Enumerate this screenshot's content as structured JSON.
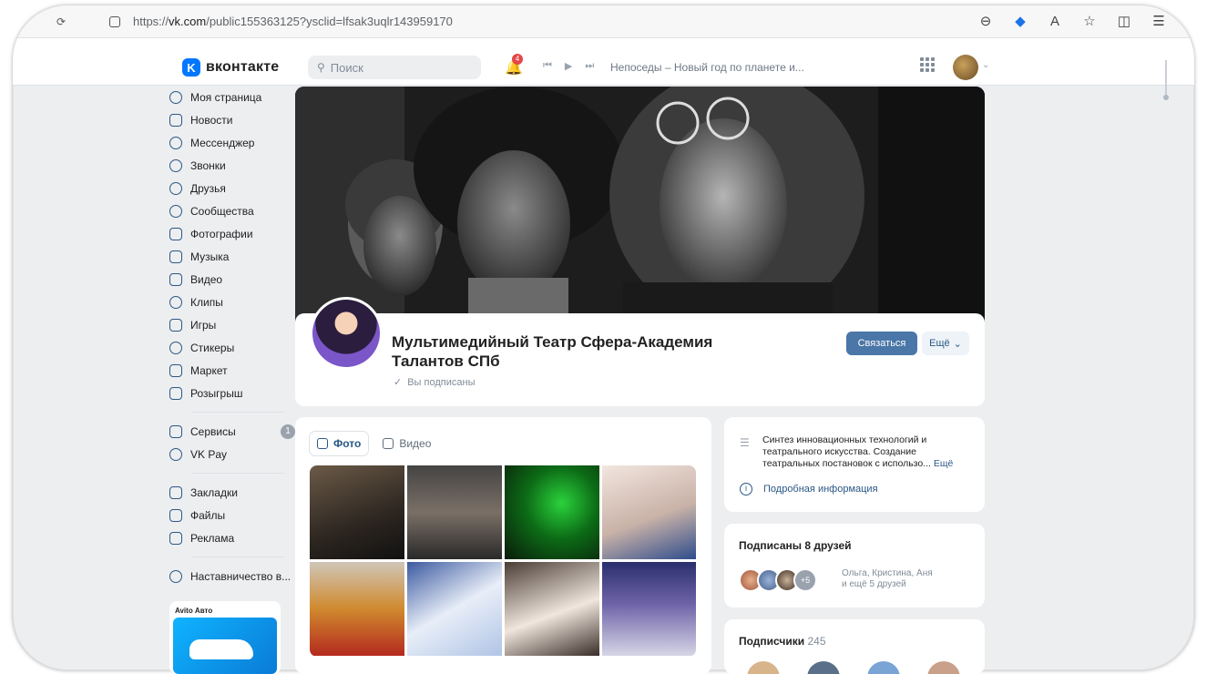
{
  "browser": {
    "url_prefix": "https://",
    "url_domain": "vk.com",
    "url_rest": "/public155363125?ysclid=lfsak3uqlr143959170"
  },
  "header": {
    "logo_text": "вконтакте",
    "search_placeholder": "Поиск",
    "notification_count": "4",
    "now_playing": "Непоседы – Новый год по планете и..."
  },
  "nav": {
    "items": [
      {
        "label": "Моя страница"
      },
      {
        "label": "Новости"
      },
      {
        "label": "Мессенджер"
      },
      {
        "label": "Звонки"
      },
      {
        "label": "Друзья"
      },
      {
        "label": "Сообщества"
      },
      {
        "label": "Фотографии"
      },
      {
        "label": "Музыка"
      },
      {
        "label": "Видео"
      },
      {
        "label": "Клипы"
      },
      {
        "label": "Игры"
      },
      {
        "label": "Стикеры"
      },
      {
        "label": "Маркет"
      },
      {
        "label": "Розыгрыш"
      }
    ],
    "services": [
      {
        "label": "Сервисы",
        "count": "1"
      },
      {
        "label": "VK Pay"
      }
    ],
    "extra": [
      {
        "label": "Закладки"
      },
      {
        "label": "Файлы"
      },
      {
        "label": "Реклама"
      }
    ],
    "mentor": {
      "label": "Наставничество в..."
    },
    "ad_brand": "Avito Авто"
  },
  "group": {
    "title": "Мультимедийный Театр Сфера-Академия Талантов СПб",
    "subscribed": "Вы подписаны",
    "contact_button": "Связаться",
    "more_button": "Ещё"
  },
  "media": {
    "tab_photo": "Фото",
    "tab_video": "Видео"
  },
  "info": {
    "description": "Синтез инновационных технологий и театрального искусства. Создание театральных постановок с использо...",
    "more": "Ещё",
    "detail_link": "Подробная информация"
  },
  "friends": {
    "title": "Подписаны 8 друзей",
    "plus": "+5",
    "names_line1": "Ольга, Кристина, Аня",
    "names_line2": "и ещё 5 друзей"
  },
  "subscribers": {
    "title": "Подписчики",
    "count": "245"
  },
  "colors": {
    "accent": "#4a76a8",
    "link": "#2a5885",
    "page_bg": "#edeef0",
    "vk_blue": "#0077ff"
  }
}
